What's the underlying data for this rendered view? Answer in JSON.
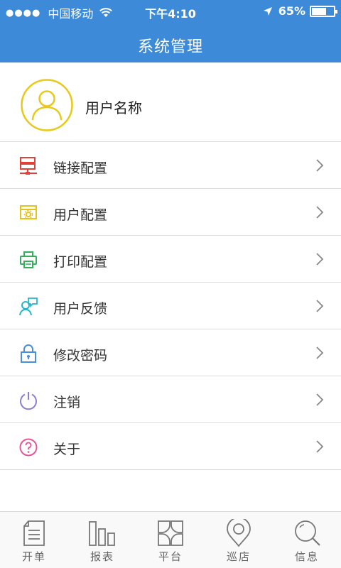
{
  "status_bar": {
    "carrier": "中国移动",
    "time": "下午4:10",
    "battery": "65%",
    "battery_level": 0.65
  },
  "nav": {
    "title": "系统管理"
  },
  "profile": {
    "name": "用户名称"
  },
  "menu": [
    {
      "label": "链接配置",
      "icon": "server-link-icon",
      "color": "#e0423a"
    },
    {
      "label": "用户配置",
      "icon": "user-settings-icon",
      "color": "#e8c21c"
    },
    {
      "label": "打印配置",
      "icon": "printer-icon",
      "color": "#35b05a"
    },
    {
      "label": "用户反馈",
      "icon": "user-feedback-icon",
      "color": "#29b6c9"
    },
    {
      "label": "修改密码",
      "icon": "lock-icon",
      "color": "#4a90d9"
    },
    {
      "label": "注销",
      "icon": "power-icon",
      "color": "#8a7fd6"
    },
    {
      "label": "关于",
      "icon": "help-icon",
      "color": "#e8539a"
    }
  ],
  "tabs": [
    {
      "label": "开单",
      "icon": "document-icon"
    },
    {
      "label": "报表",
      "icon": "bar-chart-icon"
    },
    {
      "label": "平台",
      "icon": "grid-icon"
    },
    {
      "label": "巡店",
      "icon": "location-pin-icon"
    },
    {
      "label": "信息",
      "icon": "search-icon"
    }
  ],
  "colors": {
    "header": "#3d8bd8",
    "avatar_ring": "#e8c91a",
    "tab_icon": "#777777"
  }
}
